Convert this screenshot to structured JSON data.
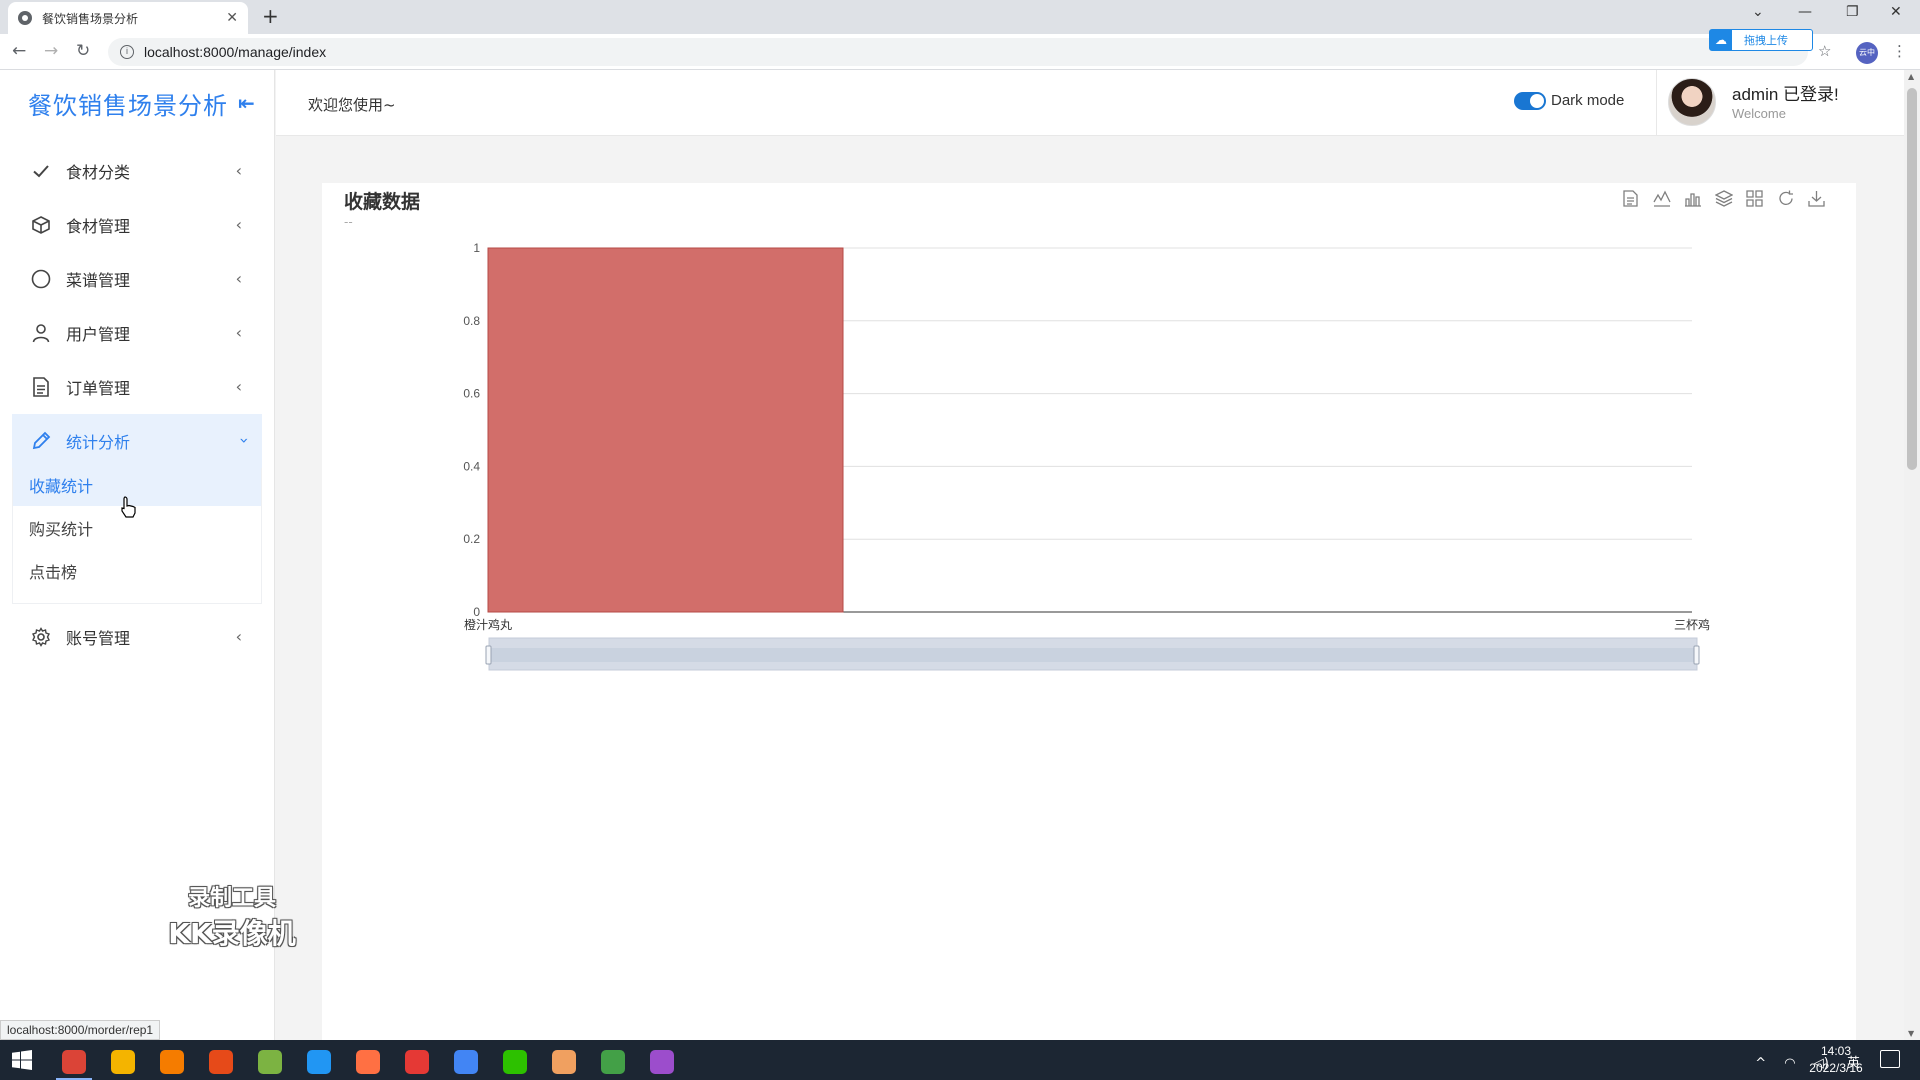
{
  "browser": {
    "tab_title": "餐饮销售场景分析",
    "url": "localhost:8000/manage/index",
    "upload_badge": "拖拽上传",
    "profile_label": "云中",
    "status_url": "localhost:8000/morder/rep1"
  },
  "brand": {
    "title": "餐饮销售场景分析"
  },
  "topbar": {
    "welcome": "欢迎您使用~",
    "dark_mode_label": "Dark mode",
    "admin_name": "admin 已登录!",
    "admin_sub": "Welcome"
  },
  "sidebar": {
    "items": [
      {
        "label": "食材分类",
        "icon": "check-icon"
      },
      {
        "label": "食材管理",
        "icon": "box-icon"
      },
      {
        "label": "菜谱管理",
        "icon": "circle-icon"
      },
      {
        "label": "用户管理",
        "icon": "user-icon"
      },
      {
        "label": "订单管理",
        "icon": "document-icon"
      },
      {
        "label": "统计分析",
        "icon": "pencil-icon"
      },
      {
        "label": "账号管理",
        "icon": "gear-icon"
      }
    ],
    "submenu": [
      {
        "label": "收藏统计"
      },
      {
        "label": "购买统计"
      },
      {
        "label": "点击榜"
      }
    ]
  },
  "chart_data": {
    "type": "bar",
    "title": "收藏数据",
    "subtitle": "--",
    "categories": [
      "橙汁鸡丸",
      "三杯鸡"
    ],
    "values": [
      1,
      0
    ],
    "ylim": [
      0,
      1
    ],
    "yticks": [
      "0",
      "0.2",
      "0.4",
      "0.6",
      "0.8",
      "1"
    ],
    "bar_color": "#d26e6a",
    "grid": true,
    "datazoom": true
  },
  "watermark": {
    "line1": "录制工具",
    "line2": "KK录像机"
  },
  "taskbar": {
    "time": "14:03",
    "date": "2022/3/16",
    "ime": "英",
    "apps": [
      {
        "name": "chrome-app",
        "color": "#db4437"
      },
      {
        "name": "explorer-app",
        "color": "#f4b400"
      },
      {
        "name": "search-app",
        "color": "#f57c00"
      },
      {
        "name": "slides-app",
        "color": "#e64a19"
      },
      {
        "name": "leaf-app",
        "color": "#7cb342"
      },
      {
        "name": "magnifier-app",
        "color": "#2196f3"
      },
      {
        "name": "game-app",
        "color": "#ff7043"
      },
      {
        "name": "wps-app",
        "color": "#e53935"
      },
      {
        "name": "baidu-app",
        "color": "#4285f4"
      },
      {
        "name": "wechat-app",
        "color": "#2dc100"
      },
      {
        "name": "avatar-app",
        "color": "#f0a060"
      },
      {
        "name": "notepad-app",
        "color": "#43a047"
      },
      {
        "name": "gear-app",
        "color": "#9c4dcc"
      }
    ]
  }
}
